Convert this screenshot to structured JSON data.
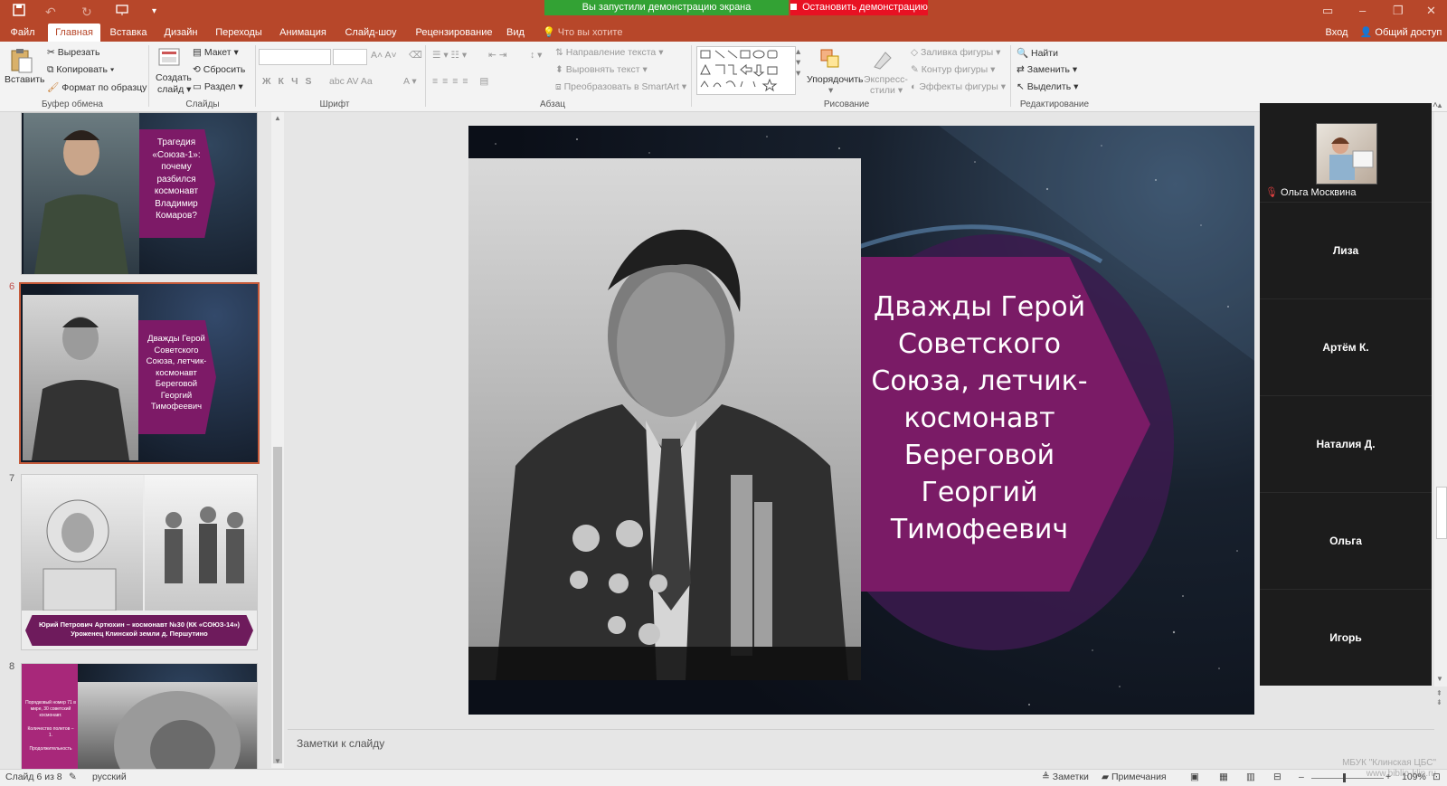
{
  "titlebar": {
    "demo_banner": "Вы запустили демонстрацию экрана",
    "demo_stop": "Остановить демонстрацию",
    "signin": "Вход",
    "share": "Общий доступ"
  },
  "tabs": [
    "Файл",
    "Главная",
    "Вставка",
    "Дизайн",
    "Переходы",
    "Анимация",
    "Слайд-шоу",
    "Рецензирование",
    "Вид"
  ],
  "tell_me": "Что вы хотите сделать?",
  "ribbon": {
    "clipboard": {
      "paste": "Вставить",
      "cut": "Вырезать",
      "copy": "Копировать",
      "format_painter": "Формат по образцу",
      "label": "Буфер обмена"
    },
    "slides": {
      "new_slide_line1": "Создать",
      "new_slide_line2": "слайд",
      "layout": "Макет",
      "reset": "Сбросить",
      "section": "Раздел",
      "label": "Слайды"
    },
    "font": {
      "label": "Шрифт"
    },
    "paragraph": {
      "text_direction": "Направление текста",
      "align_text": "Выровнять текст",
      "smartart": "Преобразовать в SmartArt",
      "label": "Абзац"
    },
    "drawing": {
      "arrange": "Упорядочить",
      "quick_styles_line1": "Экспресс-",
      "quick_styles_line2": "стили",
      "shape_fill": "Заливка фигуры",
      "shape_outline": "Контур фигуры",
      "shape_effects": "Эффекты фигуры",
      "label": "Рисование"
    },
    "editing": {
      "find": "Найти",
      "replace": "Заменить",
      "select": "Выделить",
      "label": "Редактирование"
    }
  },
  "thumbnails": {
    "slide5_text": "Трагедия «Союза-1»: почему разбился космонавт Владимир Комаров?",
    "slide6_number": "6",
    "slide6_text": "Дважды Герой Советского Союза, летчик-космонавт Береговой Георгий Тимофеевич",
    "slide7_number": "7",
    "slide7_caption_line1": "Юрий Петрович Артюхин – космонавт №30 (КК «СОЮЗ-14»)",
    "slide7_caption_line2": "Уроженец Клинской земли д. Першутино",
    "slide8_number": "8",
    "slide8_text_1": "Порядковый номер 71 в мире, 30 советский космонавт.",
    "slide8_text_2": "Количество полетов – 1.",
    "slide8_text_3": "Продолжительность"
  },
  "slide": {
    "title": "Дважды Герой Советского Союза, летчик-космонавт Береговой Георгий Тимофеевич"
  },
  "notes_placeholder": "Заметки к слайду",
  "participants": {
    "self_name": "Ольга Москвина",
    "tiles": [
      "Лиза",
      "Артём К.",
      "Наталия Д.",
      "Ольга",
      "Игорь"
    ]
  },
  "statusbar": {
    "slide_counter": "Слайд 6 из 8",
    "language": "русский",
    "notes": "Заметки",
    "comments": "Примечания",
    "zoom": "109%"
  },
  "watermark": {
    "line1": "МБУК \"Клинская ЦБС\"",
    "line2": "www.biblio-klin.ru"
  },
  "colors": {
    "titlebar": "#b7472a",
    "accent_magenta": "#8b1d6e",
    "demo_green": "#33a234",
    "stop_red": "#e81123"
  }
}
